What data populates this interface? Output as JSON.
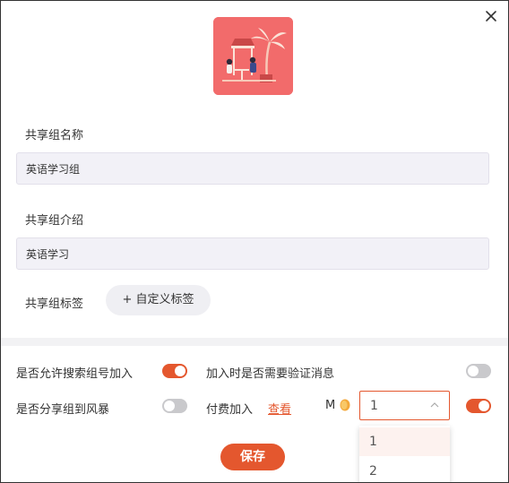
{
  "colors": {
    "accent": "#e4572e",
    "cover_bg": "#f26b6b",
    "field_bg": "#f2f1f7"
  },
  "icons": {
    "close": "close-icon",
    "cover": "beach-cafe-illustration",
    "coin": "coin-icon",
    "chevron": "chevron-up-icon"
  },
  "form": {
    "name_label": "共享组名称",
    "name_value": "英语学习组",
    "intro_label": "共享组介绍",
    "intro_value": "英语学习",
    "tags_label": "共享组标签",
    "add_tag_label": "+ 自定义标签"
  },
  "settings": {
    "allow_search_label": "是否允许搜索组号加入",
    "allow_search_on": true,
    "need_verify_label": "加入时是否需要验证消息",
    "need_verify_on": false,
    "share_storm_label": "是否分享组到风暴",
    "share_storm_on": false,
    "paid_join_label": "付费加入",
    "view_link_label": "查看",
    "currency_label": "M",
    "price_selected": "1",
    "price_options": [
      "1",
      "2"
    ],
    "paid_join_on": true
  },
  "actions": {
    "save_label": "保存"
  }
}
